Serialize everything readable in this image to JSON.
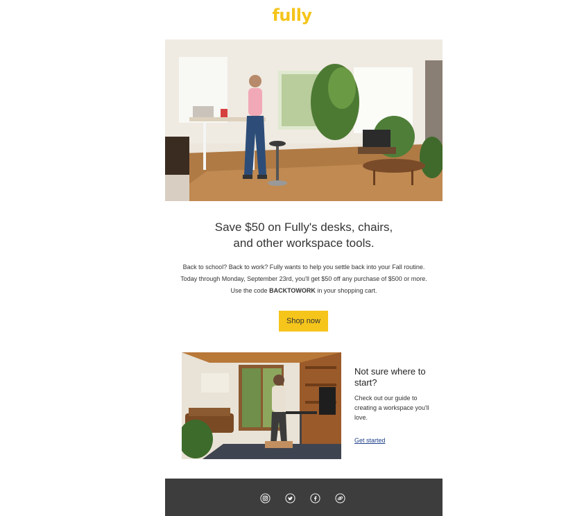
{
  "brand": {
    "logo_text": "fully",
    "accent_color": "#f5c51b"
  },
  "hero": {
    "headline_line1": "Save $50 on Fully's desks, chairs,",
    "headline_line2": "and other workspace tools.",
    "body_part1": "Back to school? Back to work? Fully wants to help you settle back into your Fall routine. Today through Monday, September 23rd, you'll get $50 off any purchase of $500 or more. Use the code ",
    "promo_code": "BACKTOWORK",
    "body_part2": " in your shopping cart.",
    "cta_label": "Shop now"
  },
  "guide": {
    "title": "Not sure where to start?",
    "text": "Check out our guide to creating a workspace you'll love.",
    "link_label": "Get started"
  },
  "footer": {
    "social_icons": [
      "instagram-icon",
      "twitter-icon",
      "facebook-icon",
      "link-icon"
    ],
    "background_color": "#3d3d3d"
  }
}
